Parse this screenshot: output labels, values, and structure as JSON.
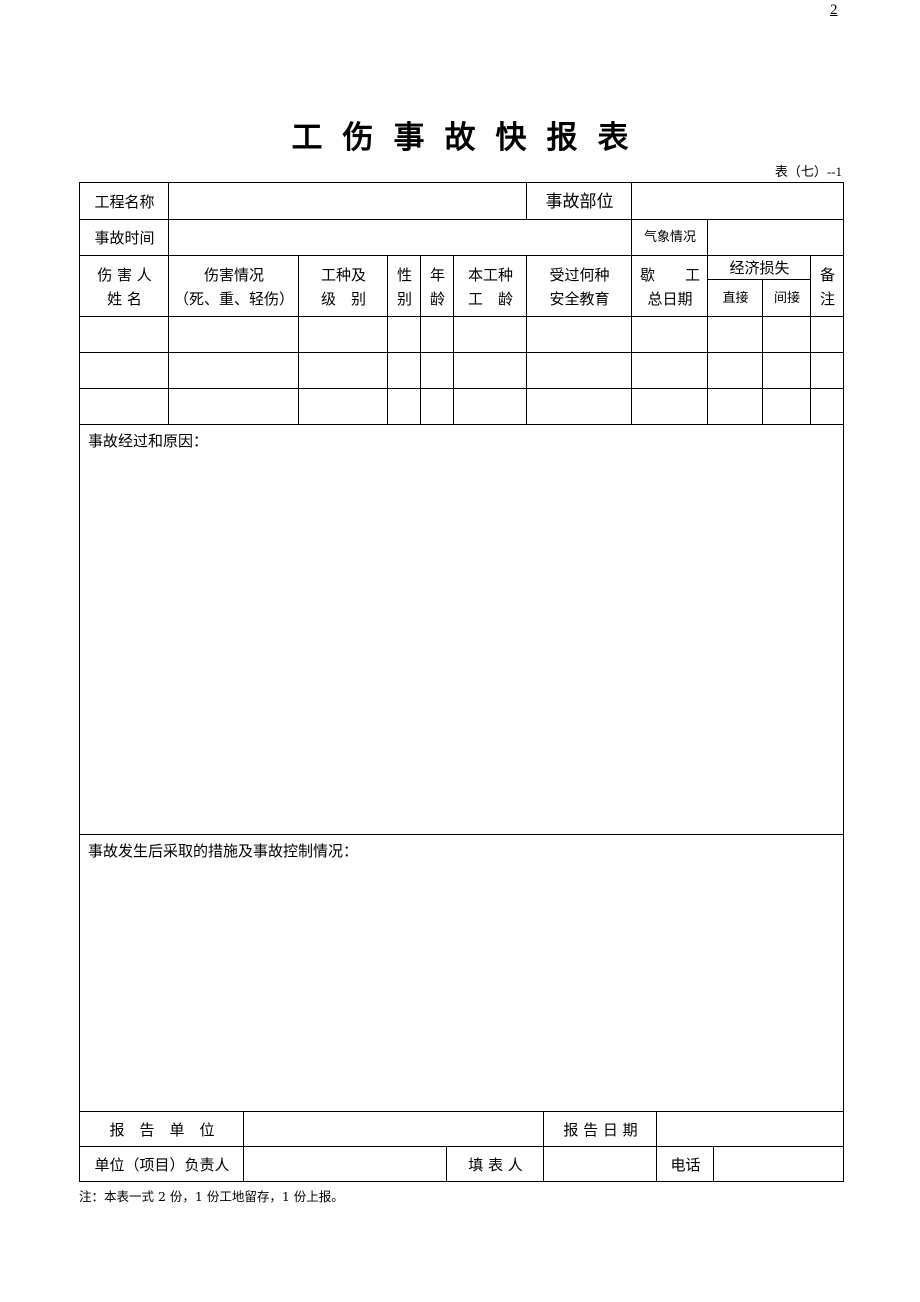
{
  "page_number": "2",
  "title": "工伤事故快报表",
  "form_code": "表（七）--1",
  "header": {
    "project_name_label": "工程名称",
    "project_name_value": "",
    "accident_location_label": "事故部位",
    "accident_location_value": "",
    "accident_time_label": "事故时间",
    "accident_time_value": "",
    "weather_label": "气象情况",
    "weather_value": ""
  },
  "columns": {
    "injured_name": "伤 害 人\n姓 名",
    "injury_status": "伤害情况\n（死、重、轻伤）",
    "trade_level": "工种及\n级　别",
    "gender": "性\n别",
    "age": "年\n龄",
    "trade_years": "本工种\n工　龄",
    "safety_training": "受过何种\n安全教育",
    "lost_days": "歇　　工\n总日期",
    "economic_loss": "经济损失",
    "direct": "直接",
    "indirect": "间接",
    "remarks": "备\n注"
  },
  "rows": [
    {
      "injured_name": "",
      "injury_status": "",
      "trade_level": "",
      "gender": "",
      "age": "",
      "trade_years": "",
      "safety_training": "",
      "lost_days": "",
      "direct": "",
      "indirect": "",
      "remarks": ""
    },
    {
      "injured_name": "",
      "injury_status": "",
      "trade_level": "",
      "gender": "",
      "age": "",
      "trade_years": "",
      "safety_training": "",
      "lost_days": "",
      "direct": "",
      "indirect": "",
      "remarks": ""
    },
    {
      "injured_name": "",
      "injury_status": "",
      "trade_level": "",
      "gender": "",
      "age": "",
      "trade_years": "",
      "safety_training": "",
      "lost_days": "",
      "direct": "",
      "indirect": "",
      "remarks": ""
    }
  ],
  "sections": {
    "process_cause_label": "事故经过和原因：",
    "process_cause_value": "",
    "measures_label": "事故发生后采取的措施及事故控制情况：",
    "measures_value": ""
  },
  "footer": {
    "report_unit_label": "报　告　单　位",
    "report_unit_value": "",
    "report_date_label": "报 告 日 期",
    "report_date_value": "",
    "responsible_label": "单位（项目）负责人",
    "responsible_value": "",
    "filler_label": "填 表 人",
    "filler_value": "",
    "phone_label": "电话",
    "phone_value": ""
  },
  "note": "注：本表一式 2 份，1 份工地留存，1 份上报。"
}
